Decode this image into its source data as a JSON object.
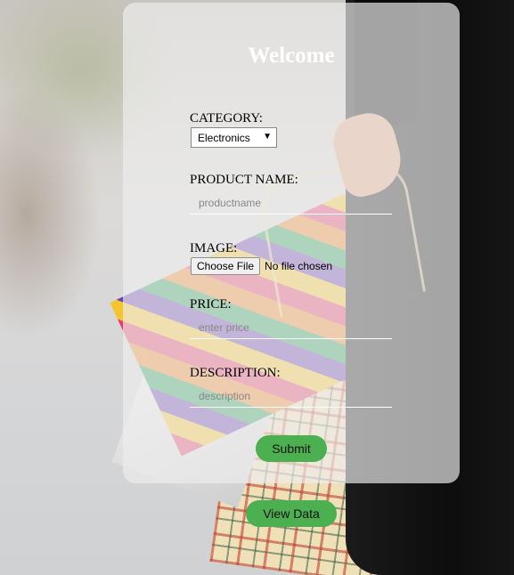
{
  "form": {
    "title": "Welcome",
    "category": {
      "label": "CATEGORY:",
      "selected": "Electronics"
    },
    "product_name": {
      "label": "PRODUCT NAME:",
      "placeholder": "productname"
    },
    "image": {
      "label": "IMAGE:",
      "button_label": "Choose File",
      "status_text": "No file chosen"
    },
    "price": {
      "label": "PRICE:",
      "placeholder": "enter price"
    },
    "description": {
      "label": "DESCRIPTION:",
      "placeholder": "description"
    },
    "submit_label": "Submit"
  },
  "view_data_label": "View Data",
  "colors": {
    "button_green": "#4caf50",
    "title_white": "#ffffff"
  },
  "icons": {
    "select_caret": "chevron-down-icon"
  }
}
